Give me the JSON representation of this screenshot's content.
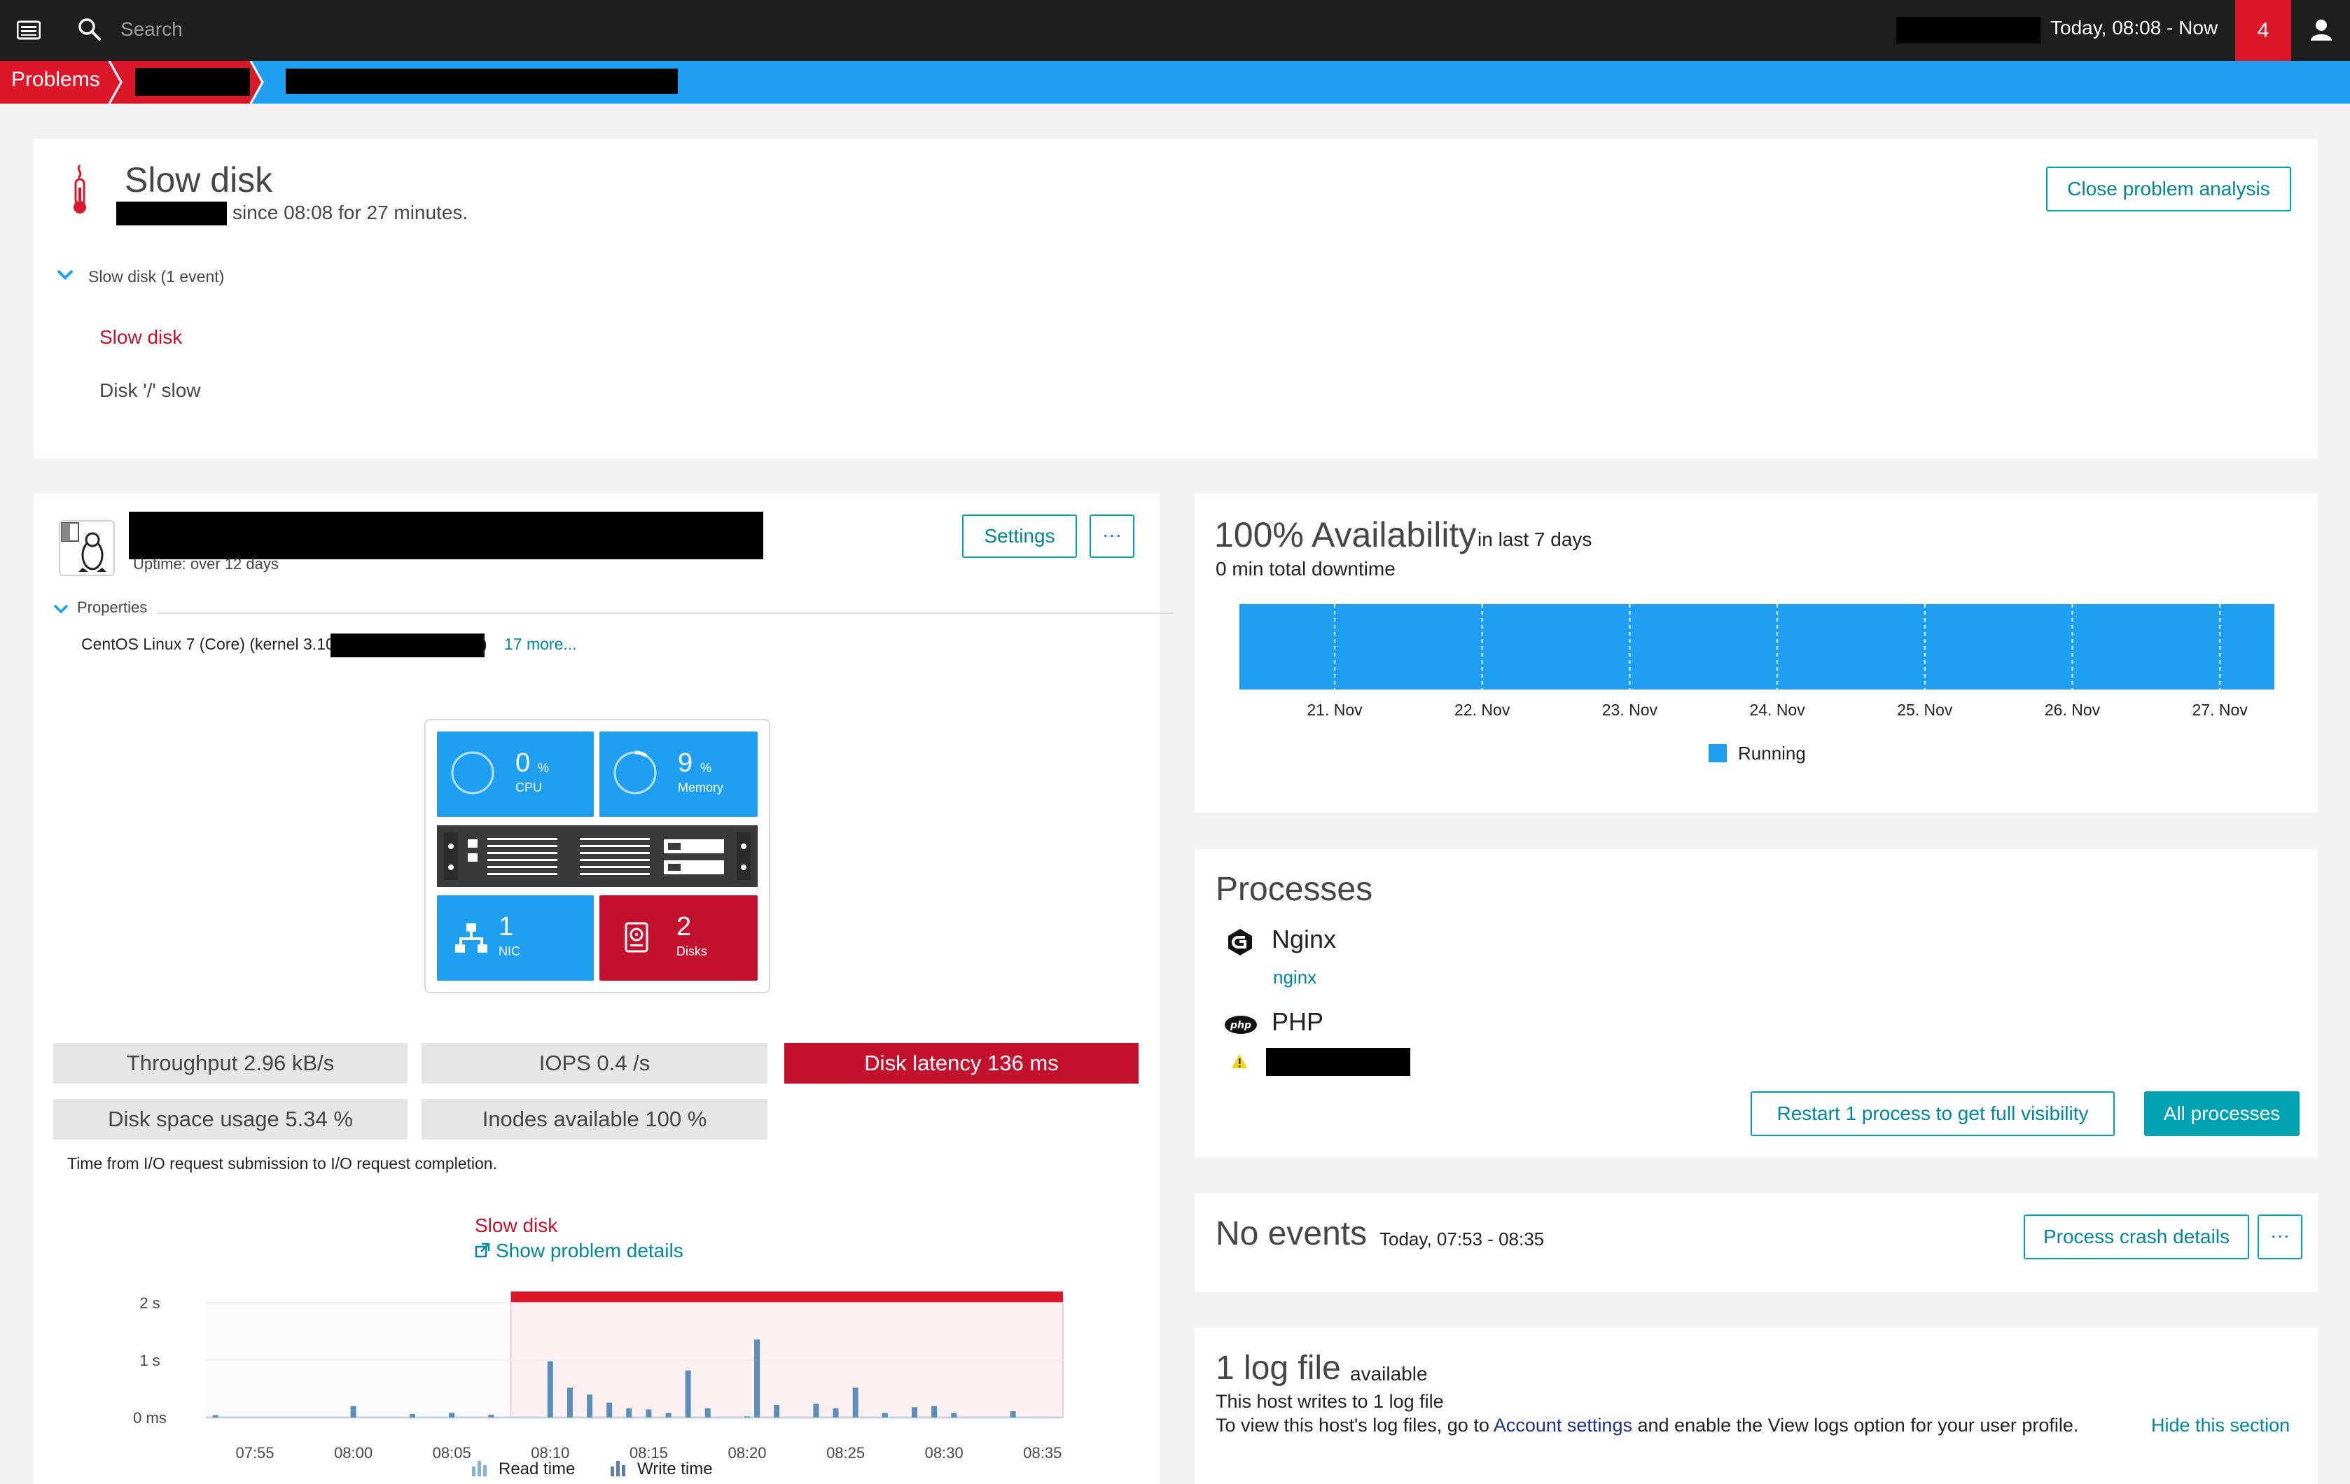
{
  "topbar": {
    "search_placeholder": "Search",
    "timeframe": "Today, 08:08 - Now",
    "problem_count": "4"
  },
  "breadcrumb": {
    "root": "Problems"
  },
  "problem": {
    "title": "Slow disk",
    "subtitle": "since 08:08 for 27 minutes.",
    "close_button": "Close problem analysis",
    "group_label": "Slow disk (1 event)",
    "event_title": "Slow disk",
    "event_detail": "Disk '/' slow"
  },
  "host": {
    "uptime": "Uptime: over 12 days",
    "settings_button": "Settings",
    "more_button": "···",
    "properties_label": "Properties",
    "os_text": "CentOS Linux 7 (Core) (kernel 3.10",
    "os_paren": ")",
    "more_link": "17 more...",
    "tiles": {
      "cpu_value": "0",
      "cpu_unit": "%",
      "cpu_label": "CPU",
      "cpu_percent": 0,
      "memory_value": "9",
      "memory_unit": "%",
      "memory_label": "Memory",
      "memory_percent": 9,
      "nic_value": "1",
      "nic_label": "NIC",
      "disks_value": "2",
      "disks_label": "Disks"
    },
    "metrics": {
      "throughput": "Throughput 2.96 kB/s",
      "iops": "IOPS 0.4 /s",
      "latency": "Disk latency 136 ms",
      "space": "Disk space usage 5.34 %",
      "inodes": "Inodes available 100 %"
    },
    "chart_caption": "Time from I/O request submission to I/O request completion.",
    "chart_problem_label": "Slow disk",
    "chart_problem_link": "Show problem details"
  },
  "chart_data": {
    "type": "bar",
    "y_ticks": [
      "2 s",
      "1 s",
      "0 ms"
    ],
    "ylim": [
      0,
      2
    ],
    "x_ticks": [
      "07:55",
      "08:00",
      "08:05",
      "08:10",
      "08:15",
      "08:20",
      "08:25",
      "08:30",
      "08:35"
    ],
    "problem_window": [
      "08:08",
      "08:36"
    ],
    "legend": [
      "Read time",
      "Write time"
    ],
    "colors": {
      "bar": "#5b8fb9",
      "problem": "#dc172a",
      "problem_bg": "#fdf0f1"
    },
    "series": [
      {
        "name": "Read time",
        "points": [
          [
            "07:53",
            0.04
          ],
          [
            "08:00",
            0.2
          ],
          [
            "08:03",
            0.06
          ],
          [
            "08:05",
            0.08
          ],
          [
            "08:07",
            0.05
          ],
          [
            "08:10",
            0.98
          ],
          [
            "08:11",
            0.52
          ],
          [
            "08:12",
            0.4
          ],
          [
            "08:13",
            0.26
          ],
          [
            "08:14",
            0.16
          ],
          [
            "08:15",
            0.14
          ],
          [
            "08:16",
            0.08
          ],
          [
            "08:17",
            0.82
          ],
          [
            "08:18",
            0.16
          ],
          [
            "08:20",
            0.02
          ],
          [
            "08:20.5",
            1.36
          ],
          [
            "08:21.5",
            0.22
          ],
          [
            "08:23.5",
            0.24
          ],
          [
            "08:24.5",
            0.16
          ],
          [
            "08:25.5",
            0.52
          ],
          [
            "08:27",
            0.08
          ],
          [
            "08:28.5",
            0.18
          ],
          [
            "08:29.5",
            0.2
          ],
          [
            "08:30.5",
            0.08
          ],
          [
            "08:33.5",
            0.11
          ]
        ]
      }
    ]
  },
  "availability": {
    "title": "100% Availability",
    "period": "in last 7 days",
    "downtime": "0 min total downtime",
    "dates": [
      "21. Nov",
      "22. Nov",
      "23. Nov",
      "24. Nov",
      "25. Nov",
      "26. Nov",
      "27. Nov"
    ],
    "legend": "Running",
    "availability_percent": 100,
    "color": "#1e9fef"
  },
  "processes": {
    "title": "Processes",
    "nginx_name": "Nginx",
    "nginx_link": "nginx",
    "php_name": "PHP",
    "restart_button": "Restart 1 process to get full visibility",
    "all_button": "All processes"
  },
  "events": {
    "title": "No events",
    "range": "Today, 07:53 - 08:35",
    "crash_button": "Process crash details",
    "more_button": "···"
  },
  "logs": {
    "title": "1 log file",
    "available": "available",
    "line1": "This host writes to 1 log file",
    "line2_pre": "To view this host's log files, go to",
    "account_link": "Account settings",
    "line2_post": "and enable the View logs option for your user profile.",
    "hide_link": "Hide this section"
  }
}
